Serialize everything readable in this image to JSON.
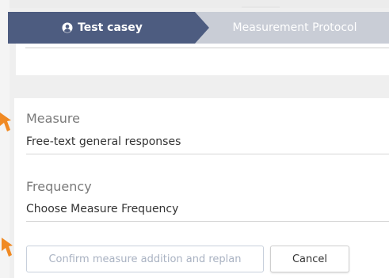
{
  "breadcrumb": {
    "active_label": "Test casey",
    "next_label": "Measurement Protocol"
  },
  "form": {
    "measure_label": "Measure",
    "measure_value": "Free-text general responses",
    "frequency_label": "Frequency",
    "frequency_value": "Choose Measure Frequency"
  },
  "actions": {
    "confirm_label": "Confirm measure addition and replan",
    "cancel_label": "Cancel"
  },
  "colors": {
    "breadcrumb_active": "#4d5c80",
    "breadcrumb_inactive": "#c9cdd6",
    "annotation_arrow": "#f08a24"
  },
  "icons": {
    "breadcrumb_user": "user-circle-icon",
    "annotation": "pointer-arrow-icon"
  }
}
